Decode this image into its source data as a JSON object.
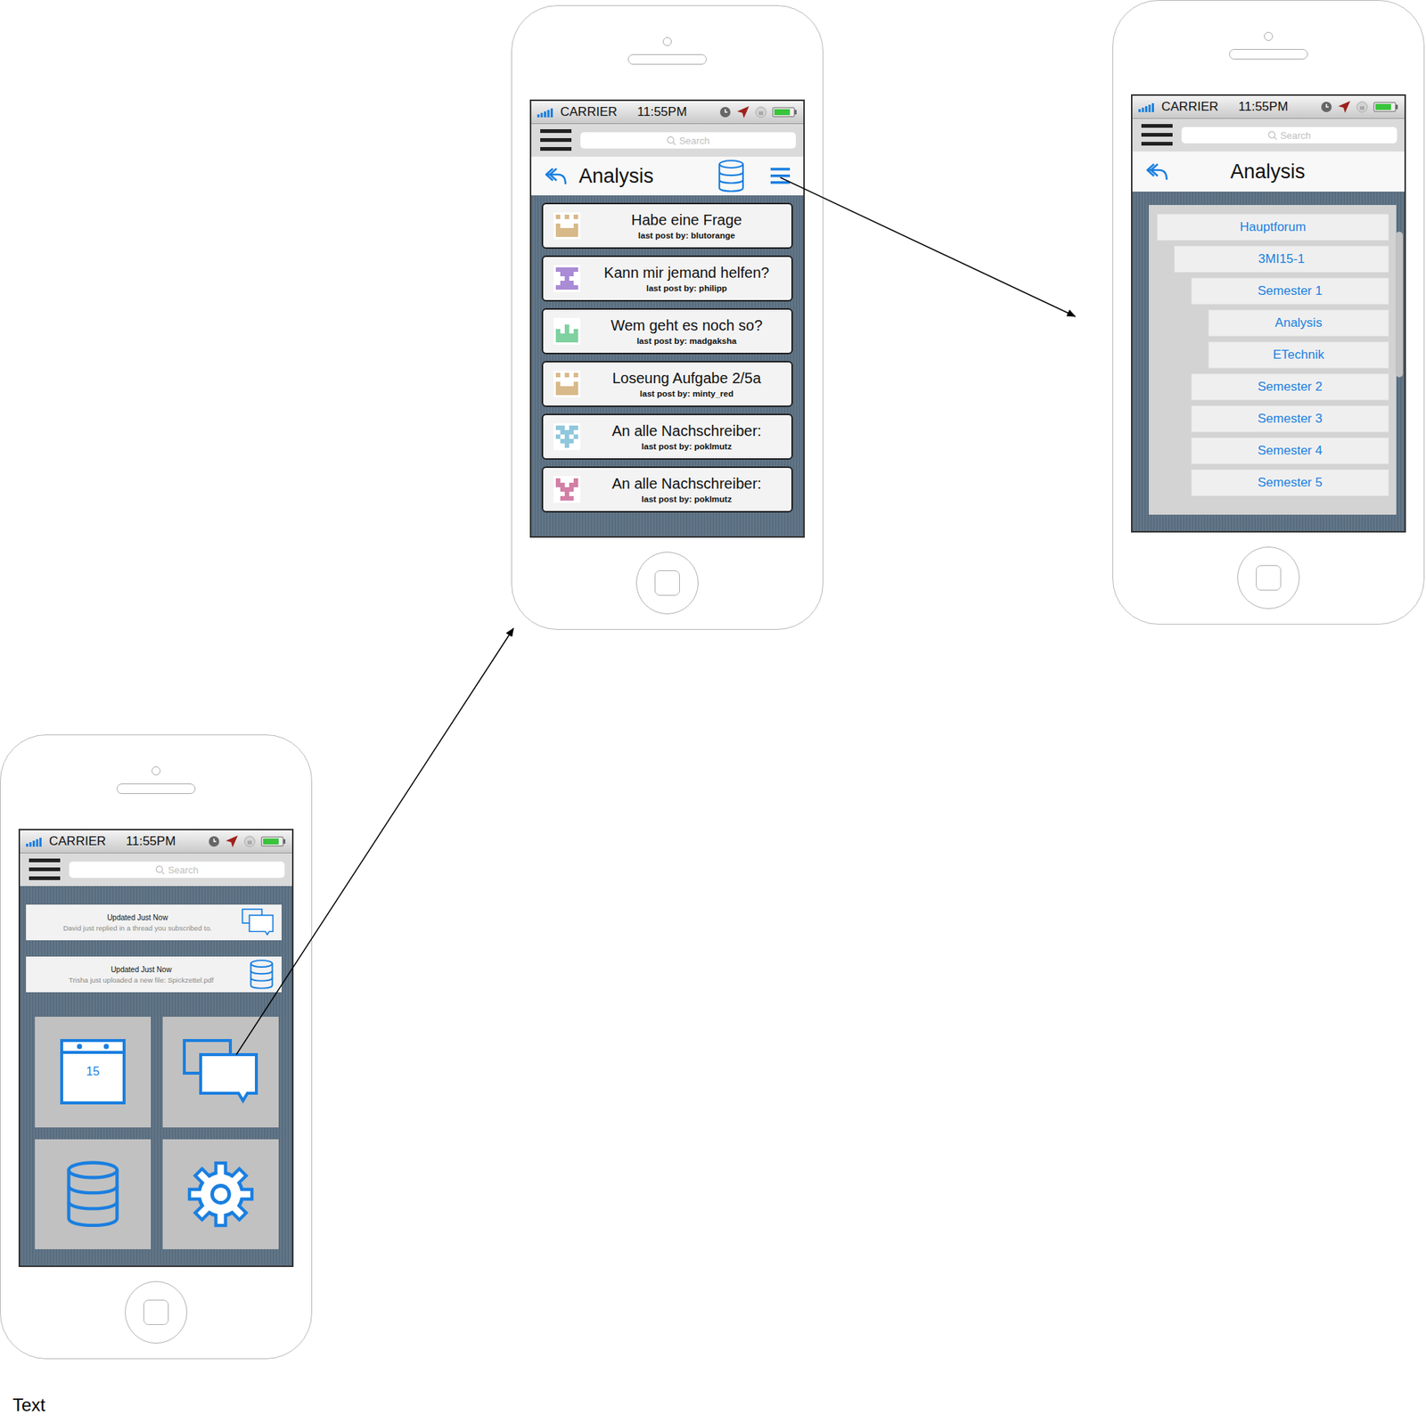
{
  "status_bar": {
    "carrier": "CARRIER",
    "time": "11:55PM"
  },
  "search": {
    "placeholder": "Search"
  },
  "home_screen": {
    "notifications": [
      {
        "title": "Updated Just Now",
        "message": "David just replied in a thread you  subscribed to.",
        "kind": "thread"
      },
      {
        "title": "Updated Just Now",
        "message": "Trisha just uploaded a new file: Spickzettel.pdf",
        "kind": "file"
      }
    ],
    "tiles": [
      {
        "kind": "calendar",
        "label": "15"
      },
      {
        "kind": "forum",
        "label": ""
      },
      {
        "kind": "files",
        "label": ""
      },
      {
        "kind": "settings",
        "label": ""
      }
    ]
  },
  "thread_screen": {
    "title": "Analysis",
    "threads": [
      {
        "title": "Habe eine Frage",
        "byline": "last post by: blutorange",
        "color": "#d8b98a"
      },
      {
        "title": "Kann mir jemand helfen?",
        "byline": "last post by: philipp",
        "color": "#a98bd6"
      },
      {
        "title": "Wem geht es noch so?",
        "byline": "last post by: madgaksha",
        "color": "#7fd1a0"
      },
      {
        "title": "Loseung Aufgabe 2/5a",
        "byline": "last post by: minty_red",
        "color": "#d8b98a"
      },
      {
        "title": "An alle Nachschreiber:",
        "byline": "last post by: poklmutz",
        "color": "#8fc7dc"
      },
      {
        "title": "An alle Nachschreiber:",
        "byline": "last post by: poklmutz",
        "color": "#d27fa6"
      }
    ]
  },
  "forum_screen": {
    "title": "Analysis",
    "items": [
      {
        "label": "Hauptforum",
        "depth": 0
      },
      {
        "label": "3MI15-1",
        "depth": 1
      },
      {
        "label": "Semester 1",
        "depth": 2
      },
      {
        "label": "Analysis",
        "depth": 3
      },
      {
        "label": "ETechnik",
        "depth": 3
      },
      {
        "label": "Semester 2",
        "depth": 2
      },
      {
        "label": "Semester 3",
        "depth": 2
      },
      {
        "label": "Semester 4",
        "depth": 2
      },
      {
        "label": "Semester 5",
        "depth": 2
      }
    ]
  },
  "caption": "Text"
}
